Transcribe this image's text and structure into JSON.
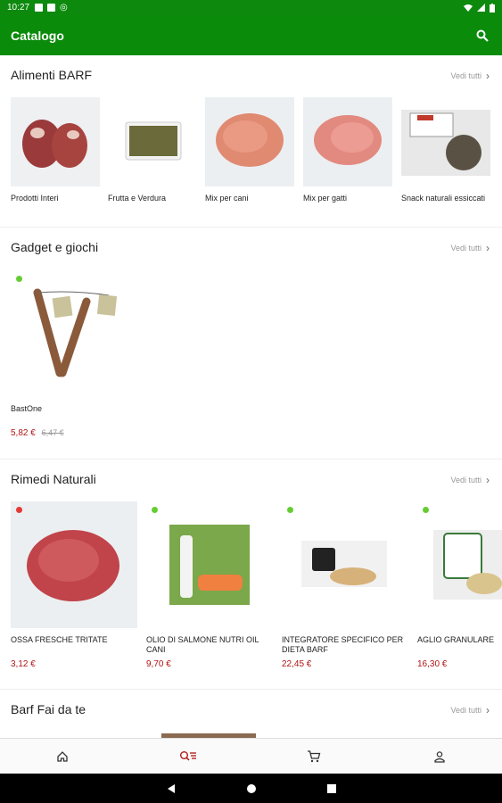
{
  "status": {
    "time": "10:27"
  },
  "appbar": {
    "title": "Catalogo"
  },
  "sections": [
    {
      "title": "Alimenti BARF",
      "see_all": "Vedi tutti",
      "items": [
        {
          "label": "Prodotti Interi"
        },
        {
          "label": "Frutta e Verdura"
        },
        {
          "label": "Mix per cani"
        },
        {
          "label": "Mix per gatti"
        },
        {
          "label": "Snack naturali essiccati"
        }
      ]
    },
    {
      "title": "Gadget e giochi",
      "see_all": "Vedi tutti",
      "items": [
        {
          "name": "BastOne",
          "price": "5,82 €",
          "old_price": "6,47 €",
          "status_color": "#66cc33"
        }
      ]
    },
    {
      "title": "Rimedi Naturali",
      "see_all": "Vedi tutti",
      "items": [
        {
          "name": "OSSA FRESCHE TRITATE",
          "price": "3,12 €",
          "status_color": "#e53935"
        },
        {
          "name": "OLIO DI SALMONE NUTRI OIL cani",
          "price": "9,70 €",
          "status_color": "#66cc33"
        },
        {
          "name": "INTEGRATORE SPECIFICO PER DIETA BARF",
          "price": "22,45 €",
          "status_color": "#66cc33"
        },
        {
          "name": "AGLIO GRANULARE",
          "price": "16,30 €",
          "status_color": "#66cc33"
        }
      ]
    },
    {
      "title": "Barf Fai da te",
      "see_all": "Vedi tutti"
    }
  ],
  "bottom_nav": [
    {
      "icon": "home-icon"
    },
    {
      "icon": "catalog-search-icon",
      "active": true
    },
    {
      "icon": "cart-icon"
    },
    {
      "icon": "account-icon"
    }
  ],
  "colors": {
    "primary": "#0a8b0a",
    "price": "#b01515",
    "active_tab": "#b01515"
  }
}
